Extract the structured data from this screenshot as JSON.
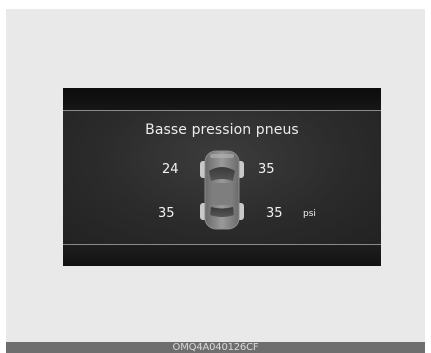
{
  "display": {
    "title": "Basse pression pneus",
    "unit": "psi",
    "tires": {
      "front_left": "24",
      "front_right": "35",
      "rear_left": "35",
      "rear_right": "35"
    },
    "car_icon": "car-top-view-icon"
  },
  "footer": {
    "code": "OMQ4A040126CF"
  },
  "colors": {
    "background": "#e9e9e9",
    "screen": "#1d1d1d",
    "text": "#f2f2f2",
    "footer_bar": "#6e6e6e"
  }
}
